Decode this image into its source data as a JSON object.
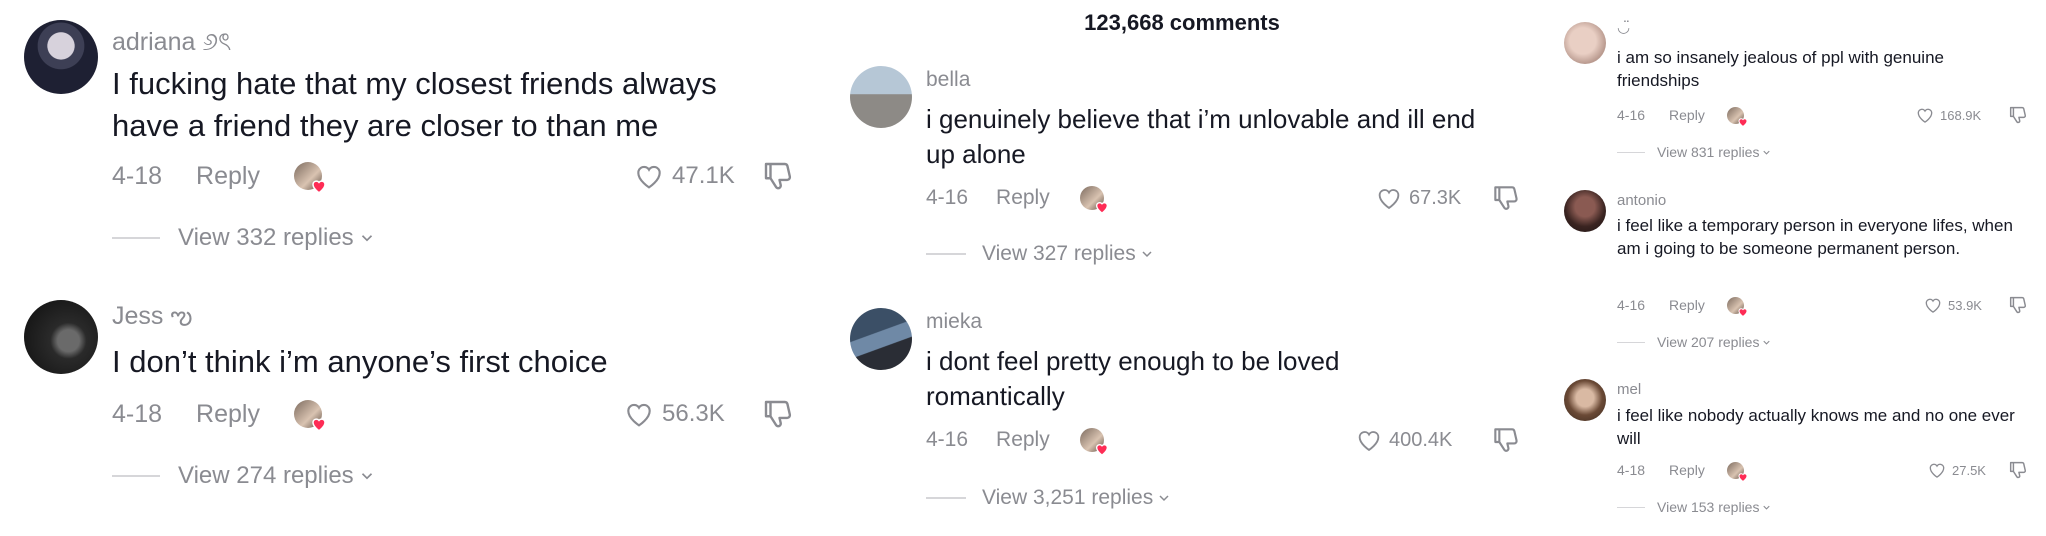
{
  "panel1": {
    "comments": [
      {
        "username": "adriana ୬ৎ",
        "text": "I fucking hate that my closest friends always have a friend they are closer to than me",
        "date": "4-18",
        "reply": "Reply",
        "likes": "47.1K",
        "view_replies": "View 332 replies"
      },
      {
        "username": "Jess ఌ",
        "text": "I don’t think i’m anyone’s first choice",
        "date": "4-18",
        "reply": "Reply",
        "likes": "56.3K",
        "view_replies": "View 274 replies"
      }
    ]
  },
  "panel2": {
    "comment_count": "123,668 comments",
    "comments": [
      {
        "username": "bella",
        "text": "i genuinely believe that i’m unlovable and ill end up alone",
        "date": "4-16",
        "reply": "Reply",
        "likes": "67.3K",
        "view_replies": "View 327 replies"
      },
      {
        "username": "mieka",
        "text": "i dont feel pretty enough to be loved romantically",
        "date": "4-16",
        "reply": "Reply",
        "likes": "400.4K",
        "view_replies": "View 3,251 replies"
      }
    ]
  },
  "panel3": {
    "comments": [
      {
        "username": "◡̈",
        "text": "i am so insanely jealous of ppl with genuine friendships",
        "date": "4-16",
        "reply": "Reply",
        "likes": "168.9K",
        "view_replies": "View 831 replies"
      },
      {
        "username": "antonio",
        "text": "i feel like a temporary person in everyone lifes, when am i going to be someone permanent person.",
        "date": "4-16",
        "reply": "Reply",
        "likes": "53.9K",
        "view_replies": "View 207 replies"
      },
      {
        "username": "mel",
        "text": "i feel like nobody actually knows me and no one ever will",
        "date": "4-18",
        "reply": "Reply",
        "likes": "27.5K",
        "view_replies": "View 153 replies"
      }
    ]
  },
  "colors": {
    "text": "#161823",
    "muted": "#8a8b91",
    "heart_badge": "#fe2c55",
    "divider": "#d6d6d9"
  },
  "icons": {
    "like": "heart-outline-icon",
    "dislike": "thumbs-down-icon",
    "chevron": "chevron-down-icon",
    "creator_badge": "heart-badge-icon"
  }
}
